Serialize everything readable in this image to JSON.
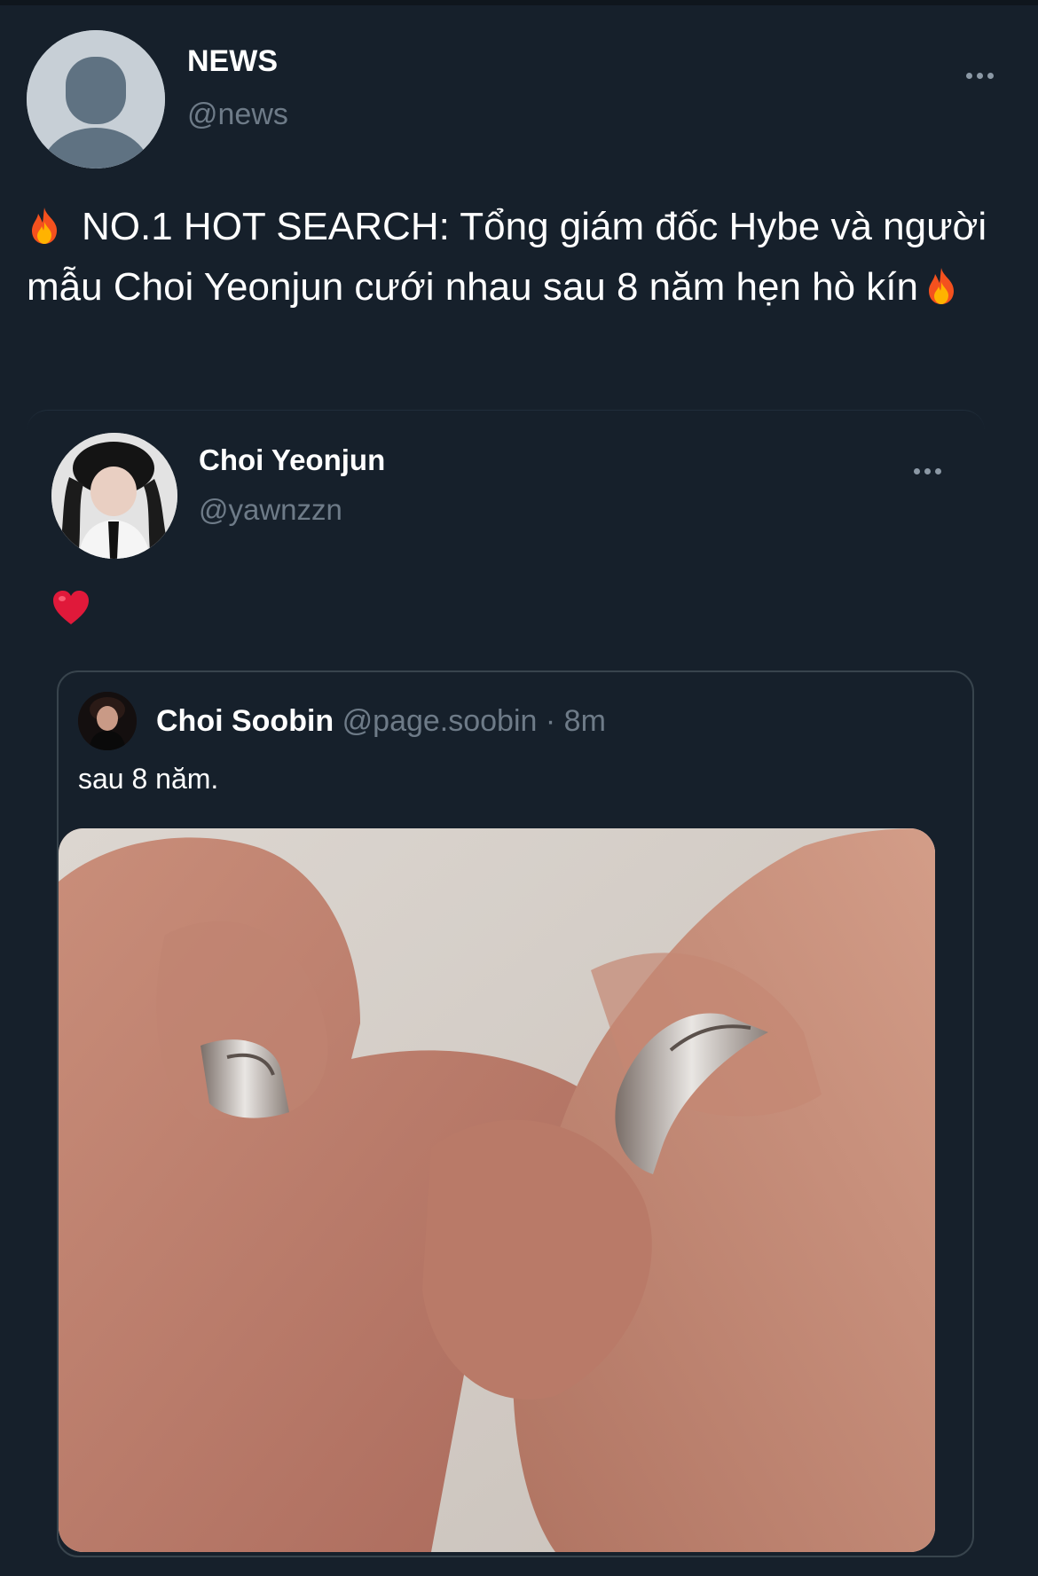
{
  "tweet": {
    "display_name": "NEWS",
    "handle": "@news",
    "avatar_icon": "default-avatar-icon",
    "text": "NO.1 HOT SEARCH: Tổng giám đốc Hybe và người mẫu Choi Yeonjun cưới nhau sau 8 năm hẹn hò kín",
    "emoji_icon": "fire-icon"
  },
  "embedded": {
    "display_name": "Choi Yeonjun",
    "handle": "@yawnzzn",
    "text_icon": "heart-icon",
    "quote": {
      "display_name": "Choi Soobin",
      "handle": "@page.soobin",
      "separator": " · ",
      "time": "8m",
      "text": "sau 8 năm.",
      "media": "photo of two hands wearing silver rings"
    }
  },
  "colors": {
    "background": "#16202b",
    "text_primary": "#ffffff",
    "text_secondary": "#6e7b88",
    "border": "#38444d"
  }
}
